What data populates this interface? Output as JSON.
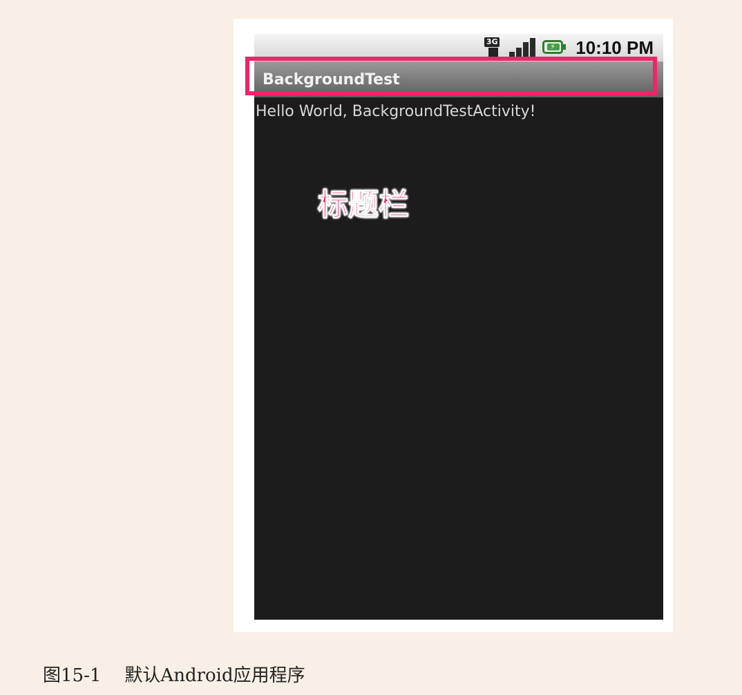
{
  "status_bar": {
    "network_badge": "3G",
    "time": "10:10 PM",
    "icons": [
      "3g-data-icon",
      "signal-strength-icon",
      "battery-charging-icon"
    ]
  },
  "app": {
    "title": "BackgroundTest",
    "body_text": "Hello World, BackgroundTestActivity!"
  },
  "annotation": {
    "label": "标题栏",
    "color": "#f0246a"
  },
  "caption": {
    "figure_number": "图15-1",
    "text": "默认Android应用程序"
  },
  "colors": {
    "page_background": "#f8f0e6",
    "screen_background": "#1c1c1c",
    "title_bar": "#7a7a7a",
    "highlight": "#f0246a"
  }
}
